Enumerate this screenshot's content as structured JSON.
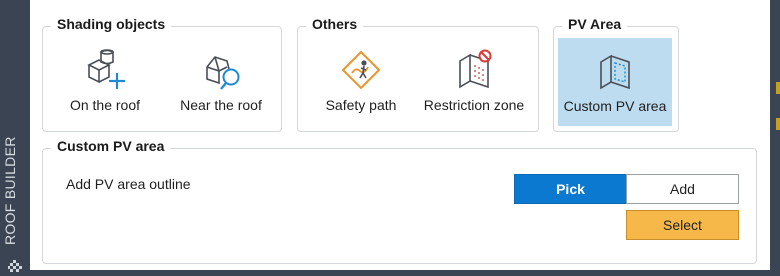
{
  "sidebar": {
    "label": "ROOF BUILDER"
  },
  "groups": {
    "shading": {
      "title": "Shading objects",
      "items": [
        {
          "label": "On the roof",
          "icon": "cube-plus-icon"
        },
        {
          "label": "Near the roof",
          "icon": "house-magnifier-icon"
        }
      ]
    },
    "others": {
      "title": "Others",
      "items": [
        {
          "label": "Safety path",
          "icon": "safety-path-icon"
        },
        {
          "label": "Restriction zone",
          "icon": "restriction-zone-icon"
        }
      ]
    },
    "pv_area": {
      "title": "PV Area",
      "items": [
        {
          "label": "Custom PV area",
          "icon": "custom-pv-area-icon",
          "active": true
        }
      ]
    }
  },
  "custom_pv": {
    "title": "Custom PV area",
    "outline_label": "Add PV area outline",
    "pick_label": "Pick",
    "add_label": "Add",
    "select_label": "Select"
  },
  "colors": {
    "accent": "#0b79d0",
    "select": "#f7b84a",
    "active_tool": "#bddcef",
    "panel_dark": "#3b4452"
  }
}
